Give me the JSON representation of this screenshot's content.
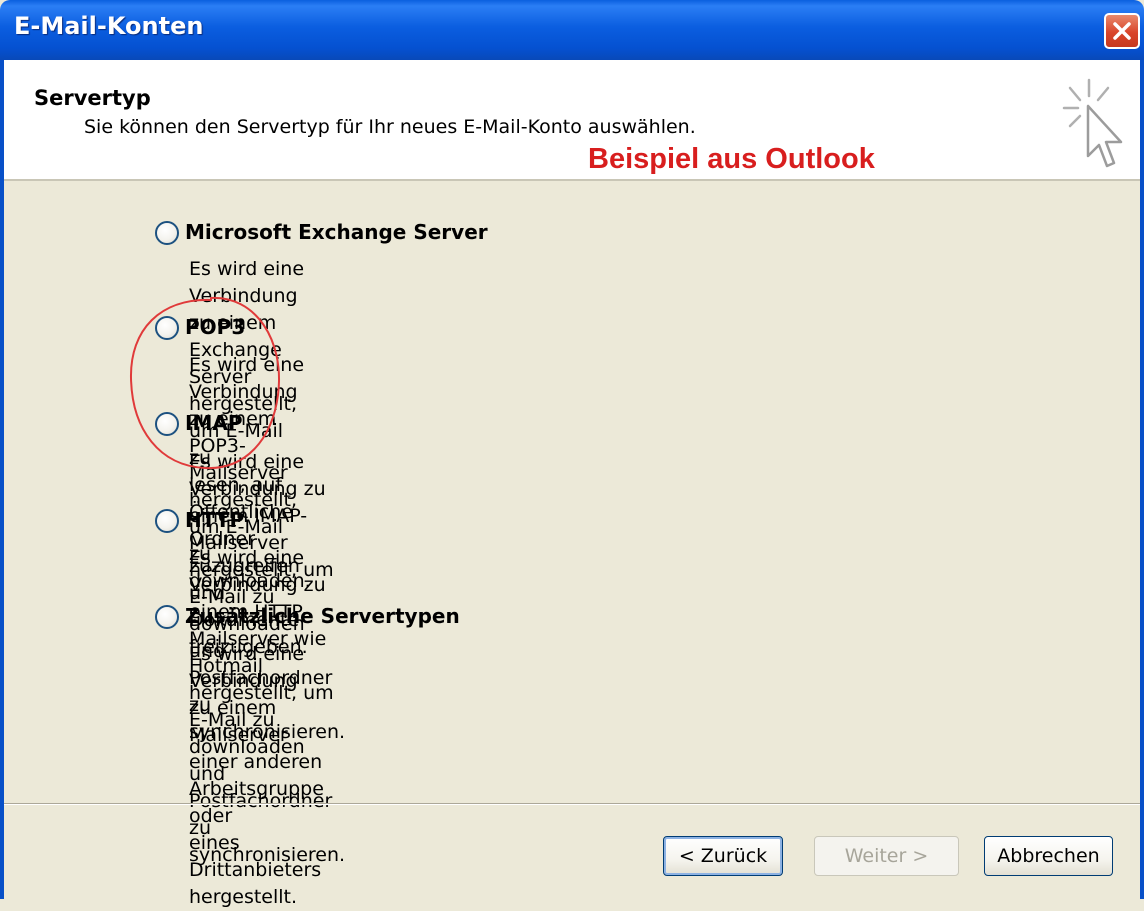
{
  "window": {
    "title": "E-Mail-Konten",
    "close_icon": "close-icon"
  },
  "header": {
    "title": "Servertyp",
    "subtitle": "Sie können den Servertyp für Ihr neues E-Mail-Konto auswählen.",
    "annotation": "Beispiel aus Outlook",
    "wizard_icon": "wizard-cursor-icon"
  },
  "options": [
    {
      "label": "Microsoft Exchange Server",
      "description_lines": [
        "Es wird eine Verbindung zu einem Exchange Server hergestellt, um E-Mail zu",
        "lesen, auf Öffentliche Ordner zuzugreifen und Dokumente freizugeben."
      ],
      "selected": false
    },
    {
      "label": "POP3",
      "description_lines": [
        "Es wird eine Verbindung zu einem POP3-Mailserver hergestellt, um E-Mail zu",
        "downloaden."
      ],
      "selected": false
    },
    {
      "label": "IMAP",
      "description_lines": [
        "Es wird eine Verbindung zu einem IMAP-Mailserver hergestellt, um E-Mail zu",
        "downloaden und Postfachordner zu synchronisieren."
      ],
      "selected": false
    },
    {
      "label": "HTTP",
      "description_lines": [
        "Es wird eine Verbindung zu einem HTTP-Mailserver wie Hotmail hergestellt, um",
        "E-Mail zu downloaden und Postfachordner zu synchronisieren."
      ],
      "selected": false
    },
    {
      "label": "Zusätzliche Servertypen",
      "description_lines": [
        "Es wird eine Verbindung zu einem Mailserver einer anderen Arbeitsgruppe oder",
        "eines Drittanbieters hergestellt."
      ],
      "selected": false
    }
  ],
  "buttons": {
    "back": "< Zurück",
    "next": "Weiter >",
    "cancel": "Abbrechen"
  },
  "colors": {
    "title_bar": "#0a5fde",
    "annotation": "#d81e1e",
    "dialog_bg": "#ece9d8"
  }
}
